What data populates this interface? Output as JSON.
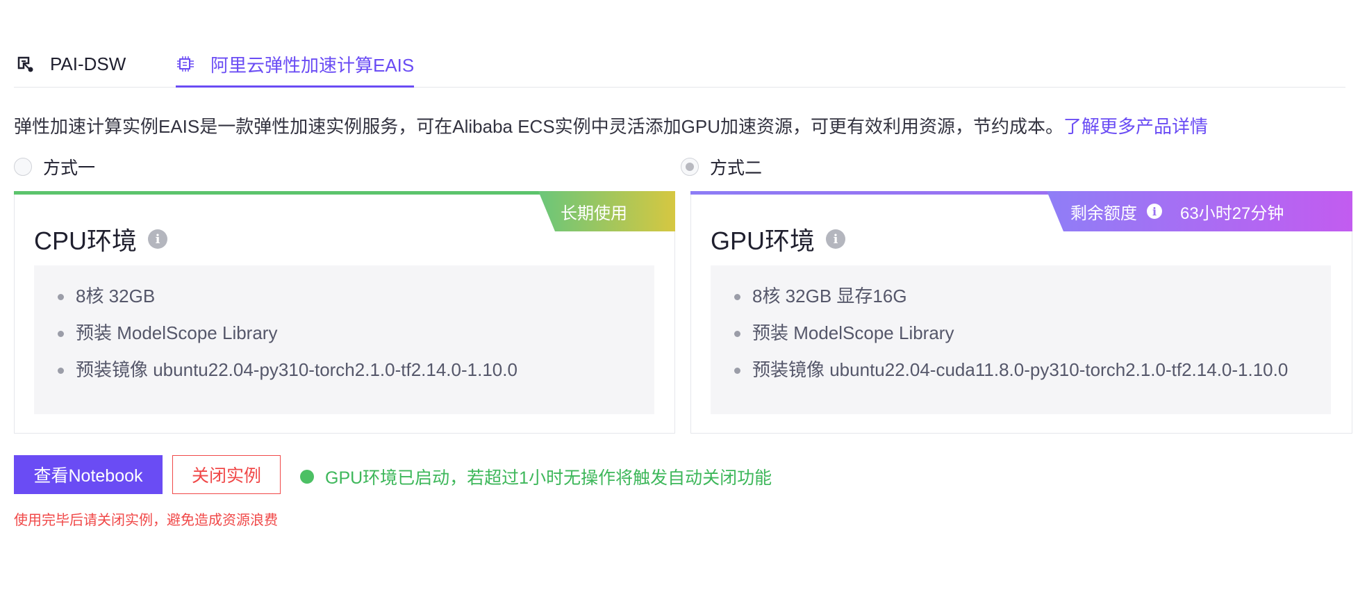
{
  "tabs": [
    {
      "label": "PAI-DSW",
      "icon": "notebook-link-icon",
      "active": false
    },
    {
      "label": "阿里云弹性加速计算EAIS",
      "icon": "chip-icon",
      "active": true
    }
  ],
  "description": {
    "text": "弹性加速计算实例EAIS是一款弹性加速实例服务，可在Alibaba ECS实例中灵活添加GPU加速资源，可更有效利用资源，节约成本。",
    "link": "了解更多产品详情"
  },
  "options": [
    {
      "label": "方式一",
      "checked": false
    },
    {
      "label": "方式二",
      "checked": true
    }
  ],
  "cards": {
    "cpu": {
      "title": "CPU环境",
      "ribbon": "长期使用",
      "specs": [
        "8核 32GB",
        "预装 ModelScope Library",
        "预装镜像  ubuntu22.04-py310-torch2.1.0-tf2.14.0-1.10.0"
      ]
    },
    "gpu": {
      "title": "GPU环境",
      "ribbon_label": "剩余额度",
      "ribbon_value": "63小时27分钟",
      "specs": [
        "8核 32GB 显存16G",
        "预装 ModelScope Library",
        "预装镜像  ubuntu22.04-cuda11.8.0-py310-torch2.1.0-tf2.14.0-1.10.0"
      ]
    }
  },
  "actions": {
    "view_notebook": "查看Notebook",
    "close_instance": "关闭实例",
    "status": "GPU环境已启动，若超过1小时无操作将触发自动关闭功能",
    "warning": "使用完毕后请关闭实例，避免造成资源浪费"
  },
  "colors": {
    "accent": "#6a4cf4",
    "success": "#4cc064",
    "danger": "#f04848"
  }
}
